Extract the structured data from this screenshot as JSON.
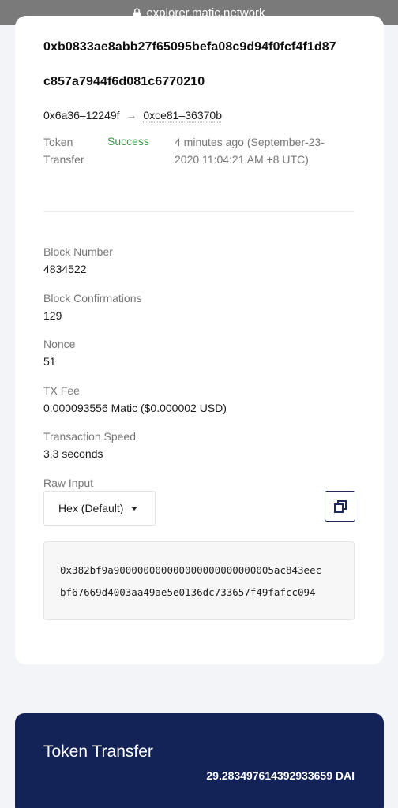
{
  "browser": {
    "url": "explorer.matic.network"
  },
  "transaction": {
    "hash_line1": "0xb0833ae8abb27f65095befa08c9d94f0fcf4f1d87",
    "hash_line2": "c857a7944f6d081c6770210",
    "from": "0x6a36–12249f",
    "arrow": "→",
    "to": "0xce81–36370b",
    "type_label": "Token Transfer",
    "status": "Success",
    "time": "4 minutes ago (September-23-2020 11:04:21 AM +8 UTC)"
  },
  "details": {
    "block_number_label": "Block Number",
    "block_number": "4834522",
    "confirmations_label": "Block Confirmations",
    "confirmations": "129",
    "nonce_label": "Nonce",
    "nonce": "51",
    "fee_label": "TX Fee",
    "fee": "0.000093556 Matic ($0.000002 USD)",
    "speed_label": "Transaction Speed",
    "speed": "3.3 seconds",
    "raw_input_label": "Raw Input"
  },
  "raw_input": {
    "format_selected": "Hex (Default)",
    "line1": "0x382bf9a900000000000000000000000005ac843eec",
    "line2": "bf67669d4003aa49ae5e0136dc733657f49fafcc094"
  },
  "token_transfer": {
    "title": "Token Transfer",
    "amount": "29.283497614392933659 DAI"
  },
  "colors": {
    "success": "#3a9a4a",
    "transfer_card_bg": "#132257",
    "page_bg": "#f3f4f8"
  },
  "icons": {
    "lock": "lock-icon",
    "caret": "caret-down-icon",
    "copy": "copy-icon"
  }
}
